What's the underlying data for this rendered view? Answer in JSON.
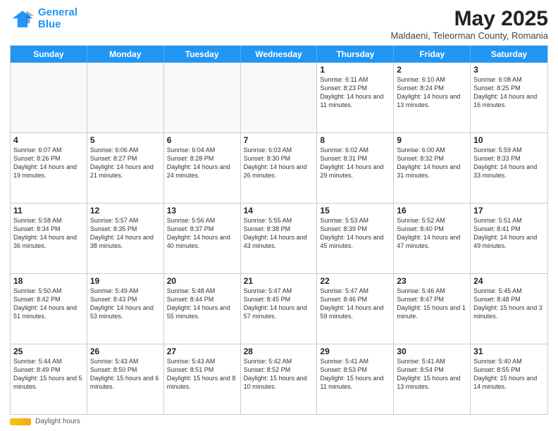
{
  "header": {
    "logo_line1": "General",
    "logo_line2": "Blue",
    "main_title": "May 2025",
    "subtitle": "Maldaeni, Teleorman County, Romania"
  },
  "days_of_week": [
    "Sunday",
    "Monday",
    "Tuesday",
    "Wednesday",
    "Thursday",
    "Friday",
    "Saturday"
  ],
  "footer": {
    "daylight_label": "Daylight hours"
  },
  "weeks": [
    [
      {
        "num": "",
        "info": "",
        "shaded": true
      },
      {
        "num": "",
        "info": "",
        "shaded": true
      },
      {
        "num": "",
        "info": "",
        "shaded": true
      },
      {
        "num": "",
        "info": "",
        "shaded": true
      },
      {
        "num": "1",
        "info": "Sunrise: 6:11 AM\nSunset: 8:23 PM\nDaylight: 14 hours\nand 11 minutes.",
        "shaded": false
      },
      {
        "num": "2",
        "info": "Sunrise: 6:10 AM\nSunset: 8:24 PM\nDaylight: 14 hours\nand 13 minutes.",
        "shaded": false
      },
      {
        "num": "3",
        "info": "Sunrise: 6:08 AM\nSunset: 8:25 PM\nDaylight: 14 hours\nand 16 minutes.",
        "shaded": false
      }
    ],
    [
      {
        "num": "4",
        "info": "Sunrise: 6:07 AM\nSunset: 8:26 PM\nDaylight: 14 hours\nand 19 minutes.",
        "shaded": false
      },
      {
        "num": "5",
        "info": "Sunrise: 6:06 AM\nSunset: 8:27 PM\nDaylight: 14 hours\nand 21 minutes.",
        "shaded": false
      },
      {
        "num": "6",
        "info": "Sunrise: 6:04 AM\nSunset: 8:28 PM\nDaylight: 14 hours\nand 24 minutes.",
        "shaded": false
      },
      {
        "num": "7",
        "info": "Sunrise: 6:03 AM\nSunset: 8:30 PM\nDaylight: 14 hours\nand 26 minutes.",
        "shaded": false
      },
      {
        "num": "8",
        "info": "Sunrise: 6:02 AM\nSunset: 8:31 PM\nDaylight: 14 hours\nand 29 minutes.",
        "shaded": false
      },
      {
        "num": "9",
        "info": "Sunrise: 6:00 AM\nSunset: 8:32 PM\nDaylight: 14 hours\nand 31 minutes.",
        "shaded": false
      },
      {
        "num": "10",
        "info": "Sunrise: 5:59 AM\nSunset: 8:33 PM\nDaylight: 14 hours\nand 33 minutes.",
        "shaded": false
      }
    ],
    [
      {
        "num": "11",
        "info": "Sunrise: 5:58 AM\nSunset: 8:34 PM\nDaylight: 14 hours\nand 36 minutes.",
        "shaded": false
      },
      {
        "num": "12",
        "info": "Sunrise: 5:57 AM\nSunset: 8:35 PM\nDaylight: 14 hours\nand 38 minutes.",
        "shaded": false
      },
      {
        "num": "13",
        "info": "Sunrise: 5:56 AM\nSunset: 8:37 PM\nDaylight: 14 hours\nand 40 minutes.",
        "shaded": false
      },
      {
        "num": "14",
        "info": "Sunrise: 5:55 AM\nSunset: 8:38 PM\nDaylight: 14 hours\nand 43 minutes.",
        "shaded": false
      },
      {
        "num": "15",
        "info": "Sunrise: 5:53 AM\nSunset: 8:39 PM\nDaylight: 14 hours\nand 45 minutes.",
        "shaded": false
      },
      {
        "num": "16",
        "info": "Sunrise: 5:52 AM\nSunset: 8:40 PM\nDaylight: 14 hours\nand 47 minutes.",
        "shaded": false
      },
      {
        "num": "17",
        "info": "Sunrise: 5:51 AM\nSunset: 8:41 PM\nDaylight: 14 hours\nand 49 minutes.",
        "shaded": false
      }
    ],
    [
      {
        "num": "18",
        "info": "Sunrise: 5:50 AM\nSunset: 8:42 PM\nDaylight: 14 hours\nand 51 minutes.",
        "shaded": false
      },
      {
        "num": "19",
        "info": "Sunrise: 5:49 AM\nSunset: 8:43 PM\nDaylight: 14 hours\nand 53 minutes.",
        "shaded": false
      },
      {
        "num": "20",
        "info": "Sunrise: 5:48 AM\nSunset: 8:44 PM\nDaylight: 14 hours\nand 55 minutes.",
        "shaded": false
      },
      {
        "num": "21",
        "info": "Sunrise: 5:47 AM\nSunset: 8:45 PM\nDaylight: 14 hours\nand 57 minutes.",
        "shaded": false
      },
      {
        "num": "22",
        "info": "Sunrise: 5:47 AM\nSunset: 8:46 PM\nDaylight: 14 hours\nand 59 minutes.",
        "shaded": false
      },
      {
        "num": "23",
        "info": "Sunrise: 5:46 AM\nSunset: 8:47 PM\nDaylight: 15 hours\nand 1 minute.",
        "shaded": false
      },
      {
        "num": "24",
        "info": "Sunrise: 5:45 AM\nSunset: 8:48 PM\nDaylight: 15 hours\nand 3 minutes.",
        "shaded": false
      }
    ],
    [
      {
        "num": "25",
        "info": "Sunrise: 5:44 AM\nSunset: 8:49 PM\nDaylight: 15 hours\nand 5 minutes.",
        "shaded": false
      },
      {
        "num": "26",
        "info": "Sunrise: 5:43 AM\nSunset: 8:50 PM\nDaylight: 15 hours\nand 6 minutes.",
        "shaded": false
      },
      {
        "num": "27",
        "info": "Sunrise: 5:43 AM\nSunset: 8:51 PM\nDaylight: 15 hours\nand 8 minutes.",
        "shaded": false
      },
      {
        "num": "28",
        "info": "Sunrise: 5:42 AM\nSunset: 8:52 PM\nDaylight: 15 hours\nand 10 minutes.",
        "shaded": false
      },
      {
        "num": "29",
        "info": "Sunrise: 5:41 AM\nSunset: 8:53 PM\nDaylight: 15 hours\nand 11 minutes.",
        "shaded": false
      },
      {
        "num": "30",
        "info": "Sunrise: 5:41 AM\nSunset: 8:54 PM\nDaylight: 15 hours\nand 13 minutes.",
        "shaded": false
      },
      {
        "num": "31",
        "info": "Sunrise: 5:40 AM\nSunset: 8:55 PM\nDaylight: 15 hours\nand 14 minutes.",
        "shaded": false
      }
    ]
  ]
}
